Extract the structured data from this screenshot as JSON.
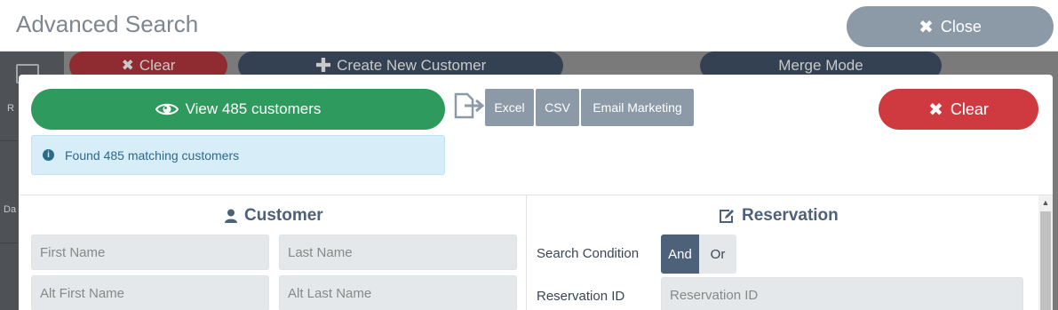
{
  "modal": {
    "title": "Advanced Search",
    "close_label": "Close"
  },
  "background": {
    "buttons": {
      "clear": "Clear",
      "create": "Create New Customer",
      "merge": "Merge Mode"
    },
    "sidebar_labels": [
      "R",
      "Da"
    ]
  },
  "actions": {
    "view_label": "View 485 customers",
    "export": {
      "excel": "Excel",
      "csv": "CSV",
      "email": "Email Marketing"
    },
    "clear_label": "Clear"
  },
  "info": {
    "message": "Found 485 matching customers"
  },
  "customer": {
    "title": "Customer",
    "fields": {
      "first_name_placeholder": "First Name",
      "last_name_placeholder": "Last Name",
      "alt_first_name_placeholder": "Alt First Name",
      "alt_last_name_placeholder": "Alt Last Name"
    }
  },
  "reservation": {
    "title": "Reservation",
    "search_condition_label": "Search Condition",
    "condition_and": "And",
    "condition_or": "Or",
    "selected_condition": "And",
    "reservation_id_label": "Reservation ID",
    "reservation_id_placeholder": "Reservation ID"
  },
  "colors": {
    "view_green": "#2f9a5d",
    "clear_red": "#cf3a40",
    "close_grey": "#8c9aa8",
    "section_blue": "#4d6179",
    "info_bg": "#d7edf7"
  },
  "icons": {
    "close": "x-icon",
    "view": "eye-icon",
    "export": "export-file-icon",
    "info": "info-circle-icon",
    "customer": "user-icon",
    "reservation": "edit-icon"
  }
}
